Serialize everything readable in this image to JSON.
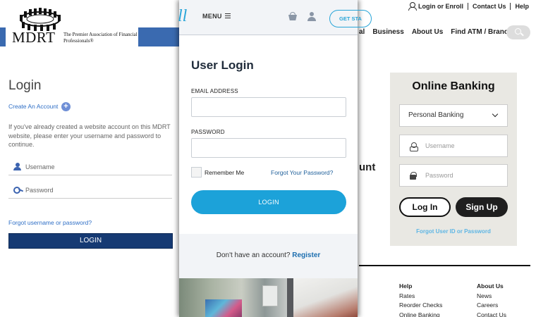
{
  "mdrt": {
    "logo_word": "MDRT",
    "logo_tagline": "The Premier Association of Financial Professionals®",
    "title": "Login",
    "create_account": "Create An Account",
    "plus": "+",
    "description": "If you've already created a website account on this MDRT website, please enter your username and password to continue.",
    "username_placeholder": "Username",
    "password_placeholder": "Password",
    "forgot": "Forgot username or password?",
    "login_button": "LOGIN",
    "brand_color": "#163a73"
  },
  "middle": {
    "logo_fragment": "ll",
    "menu": "MENU",
    "get_started": "GET STA",
    "title": "User Login",
    "email_label": "EMAIL ADDRESS",
    "password_label": "PASSWORD",
    "remember_me": "Remember Me",
    "forgot_password": "Forgot Your Password?",
    "login_button": "LOGIN",
    "no_account": "Don't have an account?",
    "register": "Register",
    "accent_color": "#1ca2d9"
  },
  "bank": {
    "util_links": [
      "Login or Enroll",
      "Contact Us",
      "Help"
    ],
    "nav": [
      "al",
      "Business",
      "About Us",
      "Find ATM / Branch"
    ],
    "fragment": "unt",
    "online_banking_title": "Online Banking",
    "select_value": "Personal Banking",
    "username_placeholder": "Username",
    "password_placeholder": "Password",
    "login_button": "Log In",
    "signup_button": "Sign Up",
    "forgot": "Forgot User ID or Password",
    "footer_help": {
      "heading": "Help",
      "items": [
        "Rates",
        "Reorder Checks",
        "Online Banking"
      ]
    },
    "footer_about": {
      "heading": "About Us",
      "items": [
        "News",
        "Careers",
        "Contact Us"
      ]
    }
  }
}
